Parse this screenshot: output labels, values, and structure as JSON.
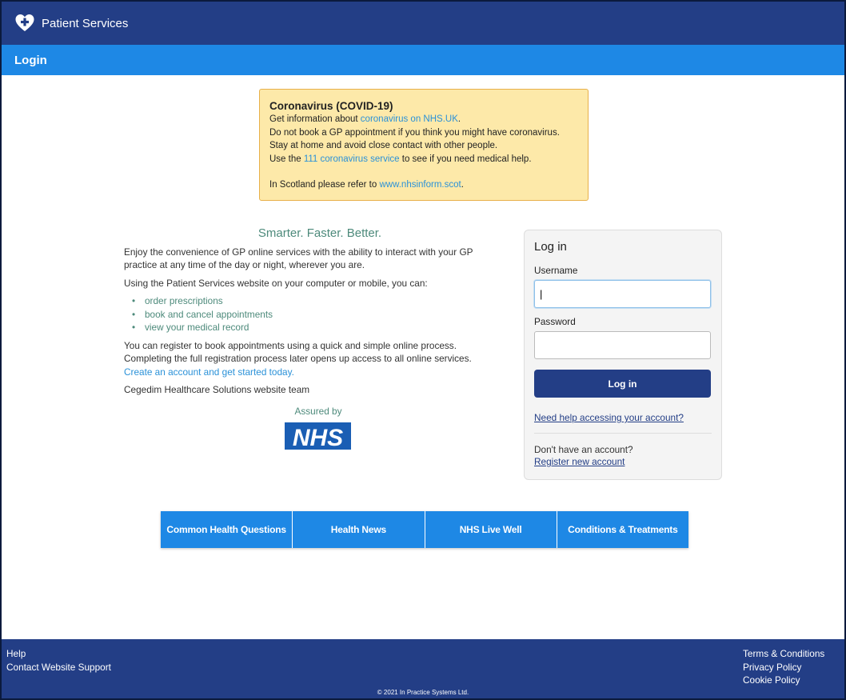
{
  "header": {
    "app_name": "Patient Services",
    "icon": "heart-plus-icon"
  },
  "subheader": {
    "title": "Login"
  },
  "covid_notice": {
    "title": "Coronavirus (COVID-19)",
    "line1_prefix": "Get information about ",
    "line1_link": "coronavirus on NHS.UK",
    "line1_suffix": ".",
    "line2": "Do not book a GP appointment if you think you might have coronavirus.",
    "line3": "Stay at home and avoid close contact with other people.",
    "line4_prefix": "Use the ",
    "line4_link": "111 coronavirus service",
    "line4_suffix": " to see if you need medical help.",
    "line5_prefix": "In Scotland please refer to ",
    "line5_link": "www.nhsinform.scot",
    "line5_suffix": "."
  },
  "intro": {
    "tagline": "Smarter. Faster. Better.",
    "paragraph1": "Enjoy the convenience of GP online services with the ability to interact with your GP practice at any time of the day or night, wherever you are.",
    "paragraph2": "Using the Patient Services website on your computer or mobile, you can:",
    "bullets": [
      "order prescriptions",
      "book and cancel appointments",
      "view your medical record"
    ],
    "paragraph3": "You can register to book appointments using a quick and simple online process. Completing the full registration process later opens up access to all online services.",
    "create_account_link": "Create an account and get started today.",
    "signoff": "Cegedim Healthcare Solutions website team",
    "assured_by": "Assured by",
    "nhs_logo_text": "NHS"
  },
  "login": {
    "title": "Log in",
    "username_label": "Username",
    "username_value": "|",
    "password_label": "Password",
    "password_value": "",
    "submit_label": "Log in",
    "help_link": "Need help accessing your account?",
    "no_account_text": "Don't have an account?",
    "register_link": "Register new account"
  },
  "tiles": [
    {
      "label": "Common Health Questions"
    },
    {
      "label": "Health News"
    },
    {
      "label": "NHS Live Well"
    },
    {
      "label": "Conditions & Treatments"
    }
  ],
  "footer": {
    "left_links": [
      "Help",
      "Contact Website Support"
    ],
    "right_links": [
      "Terms & Conditions",
      "Privacy Policy",
      "Cookie Policy"
    ],
    "copyright": "© 2021 In Practice Systems Ltd."
  },
  "colors": {
    "header_bg": "#233e86",
    "subheader_bg": "#1e88e5",
    "notice_bg": "#fde9a9",
    "accent_green": "#4d8a7b",
    "link_blue": "#2a91d8"
  }
}
